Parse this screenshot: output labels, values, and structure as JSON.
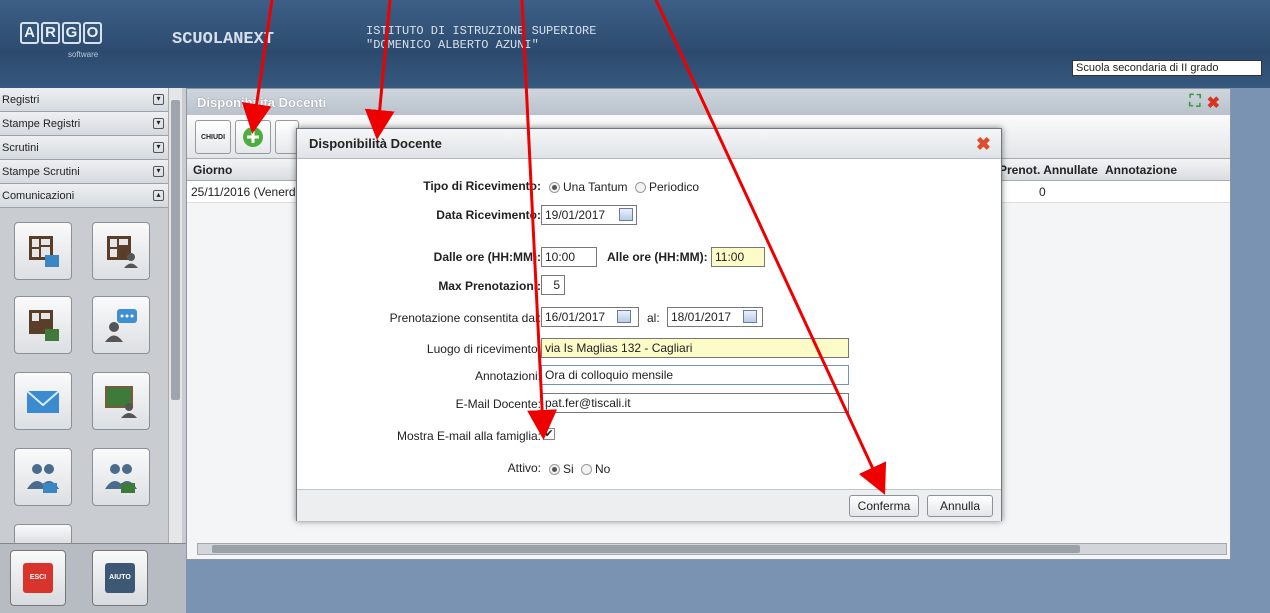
{
  "header": {
    "logo_letters": [
      "A",
      "R",
      "G",
      "O"
    ],
    "logo_sub": "software",
    "app_name": "SCUOLANEXT",
    "school_line1": "ISTITUTO DI ISTRUZIONE SUPERIORE",
    "school_line2": "\"DOMENICO ALBERTO AZUNI\"",
    "school_type": "Scuola secondaria di II grado"
  },
  "sidebar": {
    "menu": [
      {
        "label": "Registri"
      },
      {
        "label": "Stampe Registri"
      },
      {
        "label": "Scrutini"
      },
      {
        "label": "Stampe Scrutini"
      },
      {
        "label": "Comunicazioni"
      }
    ],
    "esci_label": "ESCI",
    "aiuto_label": "AIUTO"
  },
  "main": {
    "title": "Disponibilita Docenti",
    "toolbar": {
      "chiudi_label": "CHIUDI"
    },
    "grid": {
      "columns": [
        "Giorno",
        "Prenot. Annullate",
        "Annotazione"
      ],
      "rows": [
        {
          "giorno": "25/11/2016 (Venerdi",
          "annullate": "0",
          "annotazione": ""
        }
      ]
    }
  },
  "modal": {
    "title": "Disponibilità Docente",
    "tipo_label": "Tipo di Ricevimento:",
    "tipo_options": [
      "Una Tantum",
      "Periodico"
    ],
    "data_label": "Data Ricevimento:",
    "data_value": "19/01/2017",
    "dalle_label": "Dalle ore (HH:MM):",
    "dalle_value": "10:00",
    "alle_label": "Alle ore (HH:MM):",
    "alle_value": "11:00",
    "max_label": "Max Prenotazioni:",
    "max_value": "5",
    "pren_label": "Prenotazione consentita dal:",
    "pren_from": "16/01/2017",
    "al_label": "al:",
    "pren_to": "18/01/2017",
    "luogo_label": "Luogo di ricevimento:",
    "luogo_value": "via Is Maglias 132 - Cagliari",
    "annot_label": "Annotazioni:",
    "annot_value": "Ora di colloquio mensile",
    "email_label": "E-Mail Docente:",
    "email_value": "pat.fer@tiscali.it",
    "mostra_label": "Mostra E-mail alla famiglia:",
    "mostra_checked": "✔",
    "attivo_label": "Attivo:",
    "attivo_options": [
      "Si",
      "No"
    ],
    "conferma_label": "Conferma",
    "annulla_label": "Annulla"
  },
  "colors": {
    "accent": "#2c4a6e",
    "arrow": "#ee0000",
    "highlight": "#fdfbc8",
    "close": "#e14a2a"
  }
}
